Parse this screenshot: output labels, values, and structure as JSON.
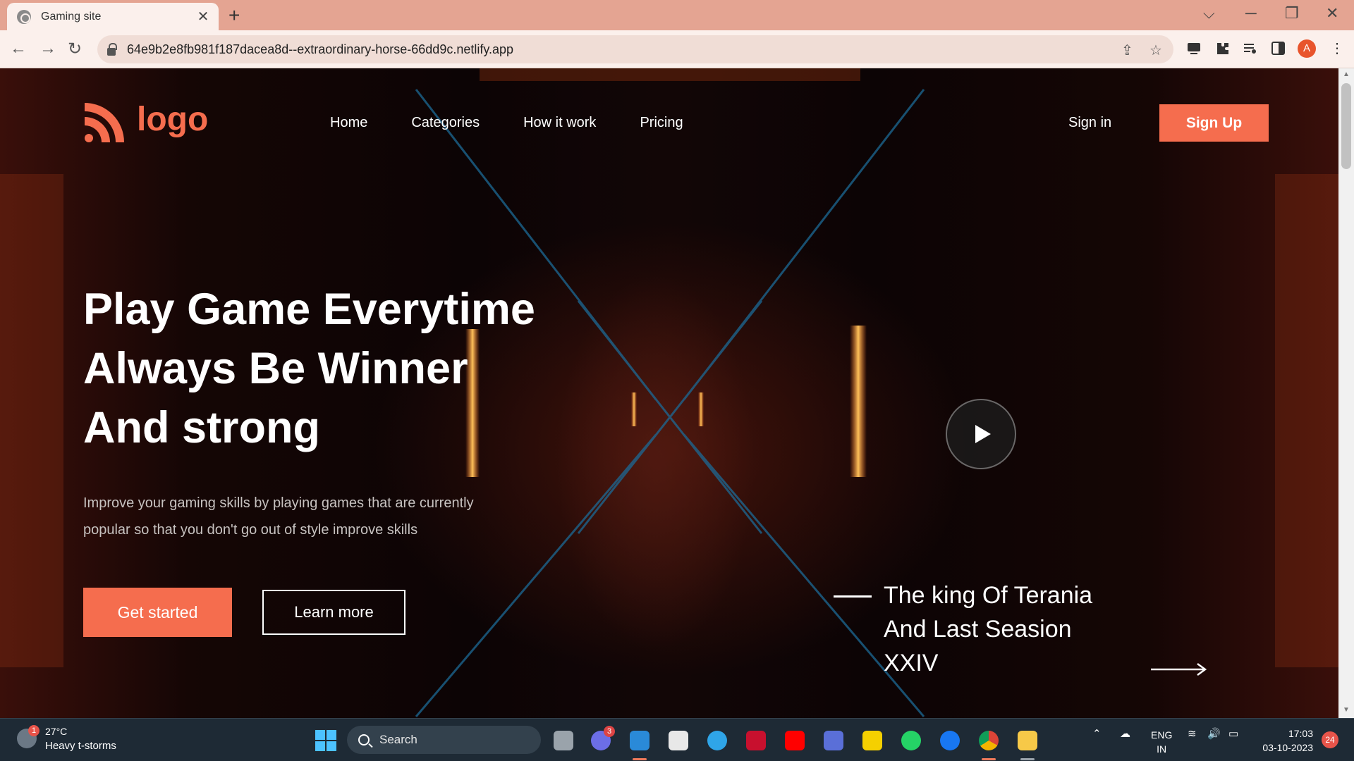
{
  "browser": {
    "tab_title": "Gaming site",
    "tab_close": "✕",
    "new_tab": "+",
    "url": "64e9b2e8fb981f187dacea8d--extraordinary-horse-66dd9c.netlify.app",
    "profile_initial": "A",
    "controls": {
      "dropdown": "⌵",
      "minimize": "─",
      "restore": "❐",
      "close": "✕"
    },
    "nav_icons": {
      "back": "←",
      "forward": "→",
      "reload": "↻"
    },
    "omni_icons": {
      "share": "⇪",
      "bookmark": "☆"
    },
    "extension_icons": [
      "screen-icon",
      "puzzle-icon",
      "media-icon",
      "sidepanel-icon",
      "menu-icon"
    ]
  },
  "site": {
    "logo_text": "logo",
    "nav": [
      "Home",
      "Categories",
      "How it work",
      "Pricing"
    ],
    "sign_in": "Sign in",
    "sign_up": "Sign Up",
    "hero": {
      "title_lines": [
        "Play Game Everytime",
        "Always Be Winner",
        "And strong"
      ],
      "description": "Improve your gaming skills by playing games that are currently popular so that you don't go out of style improve skills",
      "primary_button": "Get started",
      "secondary_button": "Learn more"
    },
    "promo": {
      "lines": [
        "The king Of Terania",
        "And Last Seasion",
        "XXIV"
      ]
    },
    "colors": {
      "accent": "#f56d4e",
      "text": "#ffffff"
    }
  },
  "taskbar": {
    "weather_badge": "1",
    "temperature": "27°C",
    "condition": "Heavy t-storms",
    "search_label": "Search",
    "teams_badge": "3",
    "lang_top": "ENG",
    "lang_bottom": "IN",
    "time": "17:03",
    "date": "03-10-2023",
    "notification_count": "24"
  }
}
